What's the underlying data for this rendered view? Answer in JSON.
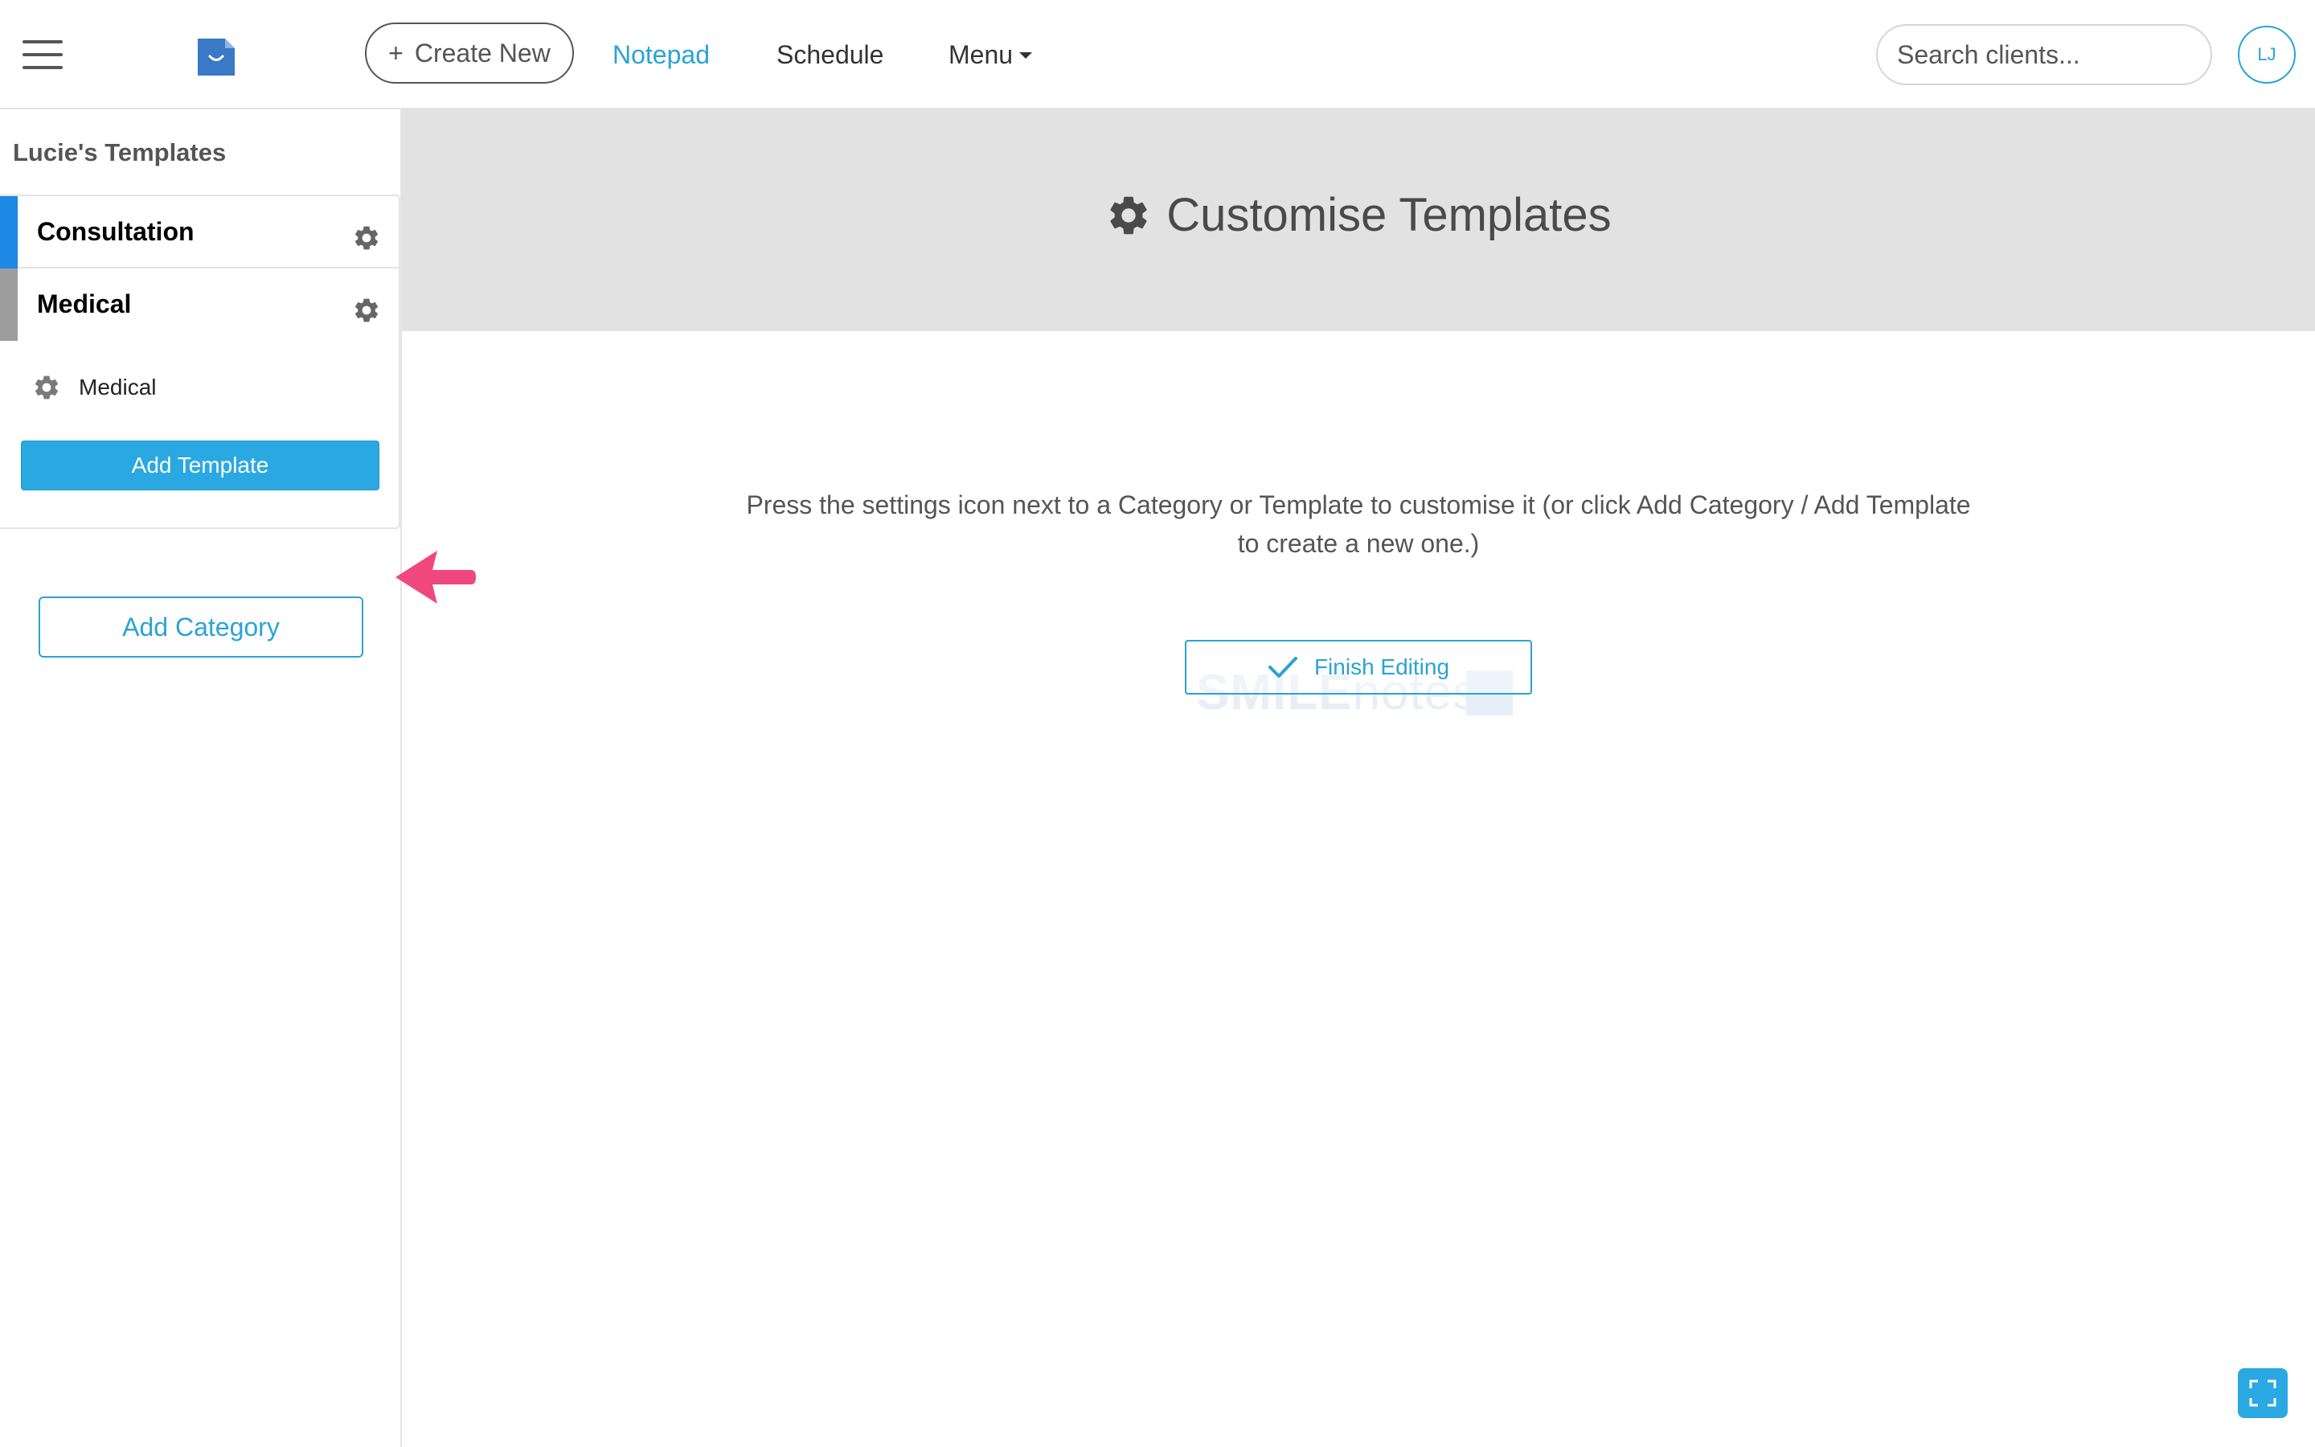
{
  "header": {
    "create_new_label": "Create New",
    "nav": {
      "notepad": "Notepad",
      "schedule": "Schedule",
      "menu": "Menu"
    },
    "search_placeholder": "Search clients...",
    "user_initials": "LJ"
  },
  "sidebar": {
    "title": "Lucie's Templates",
    "categories": [
      {
        "label": "Consultation",
        "color": "#1e88e5"
      },
      {
        "label": "Medical",
        "color": "#9e9e9e"
      }
    ],
    "templates": [
      {
        "label": "Medical"
      }
    ],
    "add_template_label": "Add Template",
    "add_category_label": "Add Category"
  },
  "main": {
    "title": "Customise Templates",
    "instructions": "Press the settings icon next to a Category or Template to customise it (or click Add Category / Add Template to create a new one.)",
    "finish_label": "Finish Editing",
    "watermark_bold": "SMILE",
    "watermark_light": "notes"
  },
  "colors": {
    "accent": "#2aa3d6",
    "button_fill": "#2aa8e2",
    "annotation_arrow": "#f0477f",
    "banner_bg": "#e2e2e2"
  },
  "icons": {
    "menu": "hamburger-icon",
    "logo": "smilenotes-logo",
    "settings": "gear-icon",
    "check": "checkmark-icon",
    "fullscreen": "expand-icon",
    "annotation": "arrow-left-icon"
  }
}
